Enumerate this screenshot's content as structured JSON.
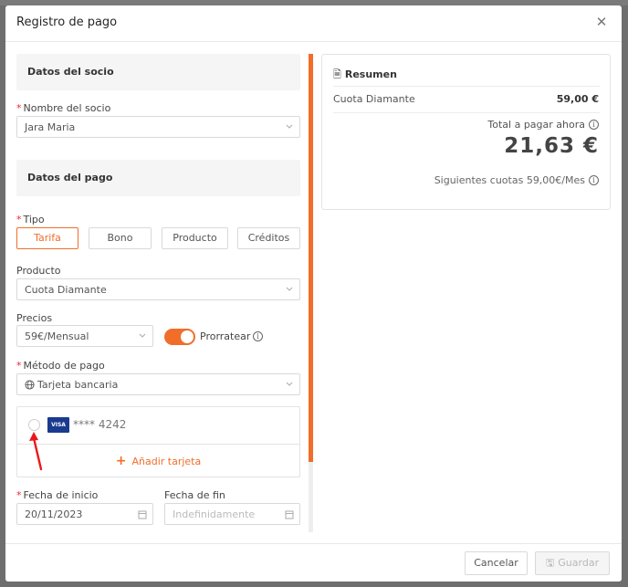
{
  "modal": {
    "title": "Registro de pago",
    "close_icon": "close-icon"
  },
  "member_section": {
    "title": "Datos del socio",
    "member_label": "Nombre del socio",
    "member_value": "Jara Maria"
  },
  "payment_section": {
    "title": "Datos del pago",
    "type_label": "Tipo",
    "types": [
      "Tarifa",
      "Bono",
      "Producto",
      "Créditos"
    ],
    "active_type": "Tarifa",
    "product_label": "Producto",
    "product_value": "Cuota Diamante",
    "prices_label": "Precios",
    "prices_value": "59€/Mensual",
    "prorate_label": "Prorratear",
    "prorate_enabled": true,
    "method_label": "Método de pago",
    "method_value": "Tarjeta bancaria",
    "method_icon": "globe-icon",
    "card_brand": "VISA",
    "card_number": "**** 4242",
    "add_card_label": "Añadir tarjeta",
    "start_date_label": "Fecha de inicio",
    "start_date_value": "20/11/2023",
    "end_date_label": "Fecha de fin",
    "end_date_placeholder": "Indefinidamente"
  },
  "summary": {
    "title": "Resumen",
    "line_label": "Cuota Diamante",
    "line_value": "59,00 €",
    "total_label": "Total a pagar ahora",
    "total_amount": "21,63 €",
    "next_fees": "Siguientes cuotas 59,00€/Mes"
  },
  "footer": {
    "cancel_label": "Cancelar",
    "save_label": "Guardar"
  },
  "colors": {
    "accent": "#f06e2a",
    "required": "#f5222d",
    "annotation_arrow": "#e8191c"
  }
}
